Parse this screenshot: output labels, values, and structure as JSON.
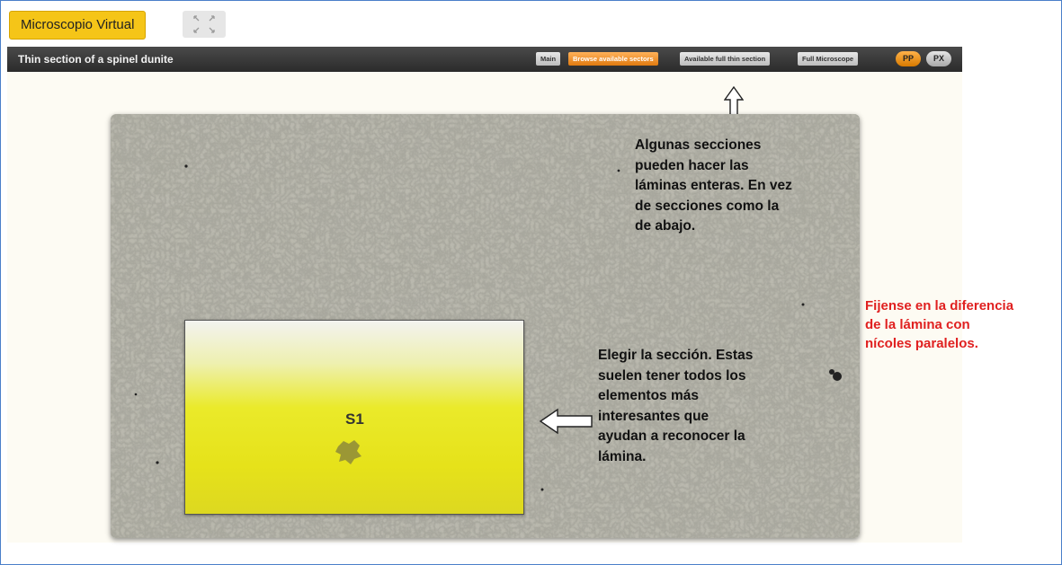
{
  "app": {
    "tab_label": "Microscopio Virtual"
  },
  "toolbar": {
    "title": "Thin section of a spinel dunite",
    "buttons": [
      {
        "label": "Main",
        "active": false
      },
      {
        "label": "Browse available sectors",
        "active": true
      },
      {
        "label": "Available full thin section",
        "active": false
      },
      {
        "label": "Full Microscope",
        "active": false
      }
    ],
    "pp_label": "PP",
    "px_label": "PX"
  },
  "sections": [
    {
      "label": "S1"
    }
  ],
  "annotations": {
    "top_note": [
      "Algunas secciones",
      "pueden hacer las",
      "láminas enteras. En vez",
      "de secciones como la",
      "de abajo."
    ],
    "side_note": [
      "Elegir la sección. Estas",
      "suelen tener todos los",
      "elementos más",
      "interesantes que",
      "ayudan a reconocer la",
      "lámina."
    ],
    "red_note": [
      "Fijense en la diferencia",
      "de la lámina con",
      "nícoles paralelos."
    ]
  },
  "colors": {
    "accent_orange": "#e07a10",
    "chip_yellow": "#f5c518",
    "note_red": "#e02020"
  },
  "icons": {
    "expand": "expand-icon",
    "arrow_up": "up-arrow-icon",
    "arrow_left": "left-arrow-icon"
  }
}
